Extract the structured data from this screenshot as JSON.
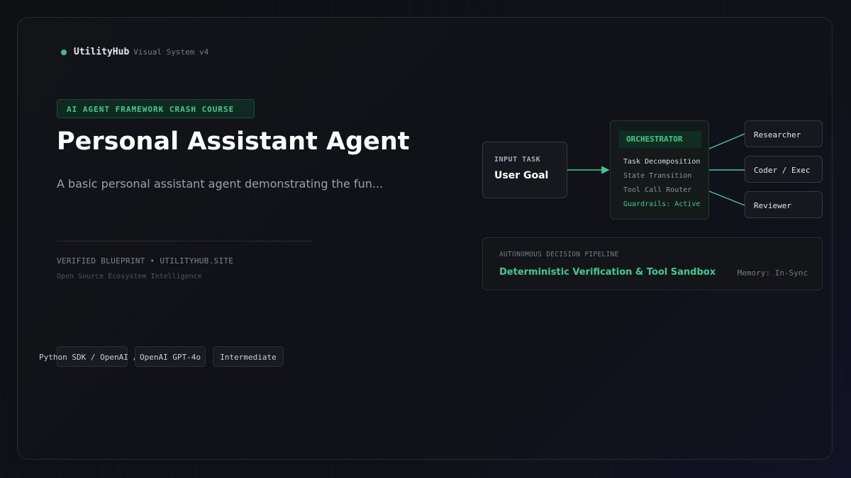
{
  "brand": {
    "name": "UtilityHub",
    "subtitle": "Visual System v4"
  },
  "hero": {
    "badge": "AI AGENT FRAMEWORK CRASH COURSE",
    "title": "Personal Assistant Agent",
    "subtitle": "A basic personal assistant agent demonstrating the fun...",
    "verified": "VERIFIED BLUEPRINT • UTILITYHUB.SITE",
    "ecosystem": "Open Source Ecosystem Intelligence"
  },
  "tags": [
    "Python SDK / OpenAI Agents SDK",
    "OpenAI GPT-4o",
    "Intermediate"
  ],
  "tag_display": [
    "Python SDK / OpenAI /",
    "OpenAI GPT-4o",
    "Intermediate"
  ],
  "diagram": {
    "input": {
      "label": "INPUT TASK",
      "value": "User Goal"
    },
    "orchestrator": {
      "title": "ORCHESTRATOR",
      "items": [
        "Task Decomposition",
        "State Transition",
        "Tool Call Router",
        "Guardrails: Active"
      ]
    },
    "workers": [
      "Researcher",
      "Coder / Exec",
      "Reviewer"
    ],
    "pipeline": {
      "label": "AUTONOMOUS DECISION PIPELINE",
      "value": "Deterministic Verification & Tool Sandbox",
      "memory": "Memory: In-Sync"
    }
  },
  "colors": {
    "accent": "#3ccb8e",
    "background": "#0d0f13",
    "card_border": "#262a31"
  }
}
